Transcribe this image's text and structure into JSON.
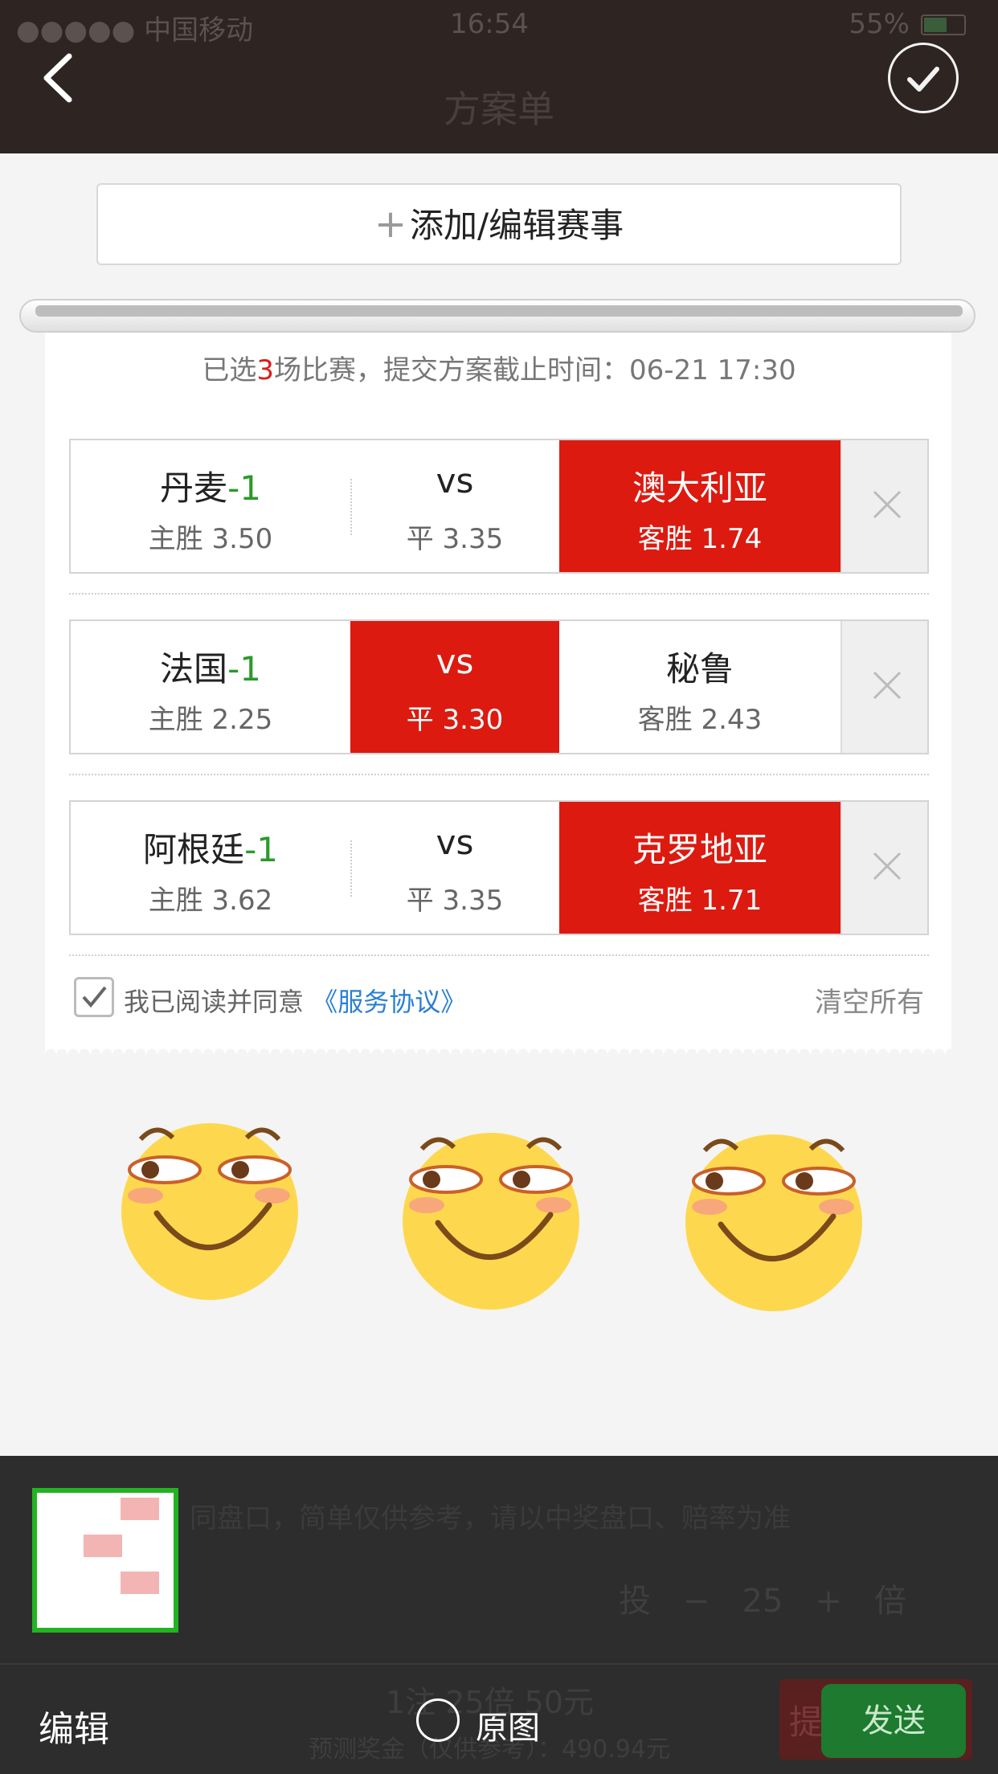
{
  "status_bar": {
    "carrier": "●●●●● 中国移动",
    "time": "16:54",
    "battery": "55%"
  },
  "header": {
    "title": "方案单"
  },
  "add_match": {
    "plus": "+",
    "label": "添加/编辑赛事"
  },
  "summary": {
    "prefix": "已选",
    "count": "3",
    "suffix": "场比赛，提交方案截止时间：06-21 17:30"
  },
  "matches": [
    {
      "home": "丹麦",
      "handicap": "-1",
      "home_odds": "主胜 3.50",
      "vs": "vs",
      "draw_odds": "平 3.35",
      "away": "澳大利亚",
      "away_odds": "客胜 1.74",
      "selected": "away"
    },
    {
      "home": "法国",
      "handicap": "-1",
      "home_odds": "主胜 2.25",
      "vs": "vs",
      "draw_odds": "平 3.30",
      "away": "秘鲁",
      "away_odds": "客胜 2.43",
      "selected": "draw"
    },
    {
      "home": "阿根廷",
      "handicap": "-1",
      "home_odds": "主胜 3.62",
      "vs": "vs",
      "draw_odds": "平 3.35",
      "away": "克罗地亚",
      "away_odds": "客胜 1.71",
      "selected": "away"
    }
  ],
  "agreement": {
    "text": "我已阅读并同意",
    "link": "《服务协议》",
    "checked": true
  },
  "clear_all": "清空所有",
  "overlay_ghost": {
    "note": "同盘口，简单仅供参考，请以中奖盘口、赔率为准",
    "stepper_prefix": "投",
    "stepper_minus": "−",
    "multiplier": "25",
    "stepper_plus": "+",
    "stepper_suffix": "倍",
    "sum": "1注 25倍 50元",
    "prize": "预测奖金（仅供参考）：490.94元",
    "submit": "提"
  },
  "bottom_bar": {
    "edit": "编辑",
    "original": "原图",
    "send": "发送"
  },
  "colors": {
    "header_bg": "#2e2523",
    "selected_red": "#dc1a10",
    "handicap_green": "#2a9a2a",
    "link_blue": "#2a7fd4",
    "send_green": "#1d7a2e",
    "thumb_border": "#22b322"
  }
}
